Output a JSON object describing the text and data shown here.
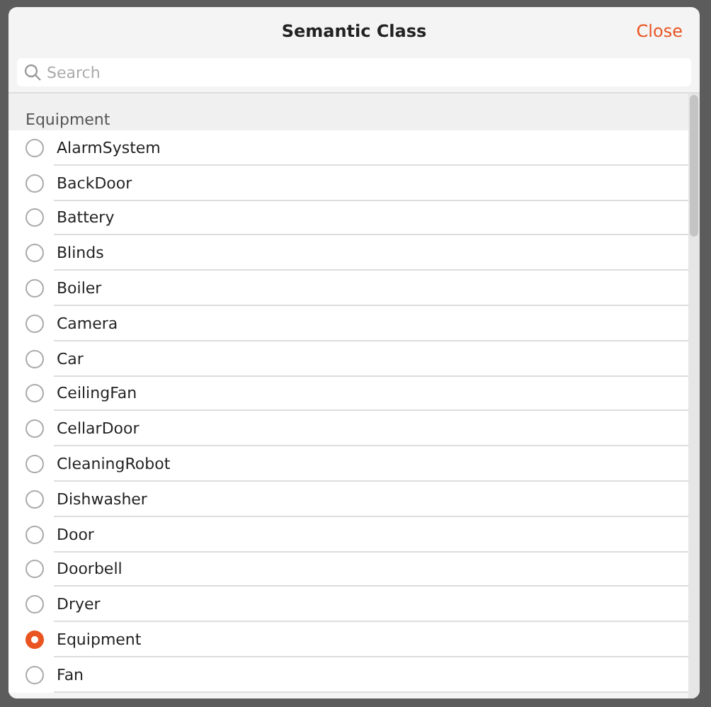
{
  "dialog": {
    "title": "Semantic Class",
    "close_label": "Close"
  },
  "search": {
    "placeholder": "Search"
  },
  "section": {
    "title": "Equipment"
  },
  "items": [
    {
      "label": "AlarmSystem",
      "selected": false
    },
    {
      "label": "BackDoor",
      "selected": false
    },
    {
      "label": "Battery",
      "selected": false
    },
    {
      "label": "Blinds",
      "selected": false
    },
    {
      "label": "Boiler",
      "selected": false
    },
    {
      "label": "Camera",
      "selected": false
    },
    {
      "label": "Car",
      "selected": false
    },
    {
      "label": "CeilingFan",
      "selected": false
    },
    {
      "label": "CellarDoor",
      "selected": false
    },
    {
      "label": "CleaningRobot",
      "selected": false
    },
    {
      "label": "Dishwasher",
      "selected": false
    },
    {
      "label": "Door",
      "selected": false
    },
    {
      "label": "Doorbell",
      "selected": false
    },
    {
      "label": "Dryer",
      "selected": false
    },
    {
      "label": "Equipment",
      "selected": true
    },
    {
      "label": "Fan",
      "selected": false
    }
  ]
}
